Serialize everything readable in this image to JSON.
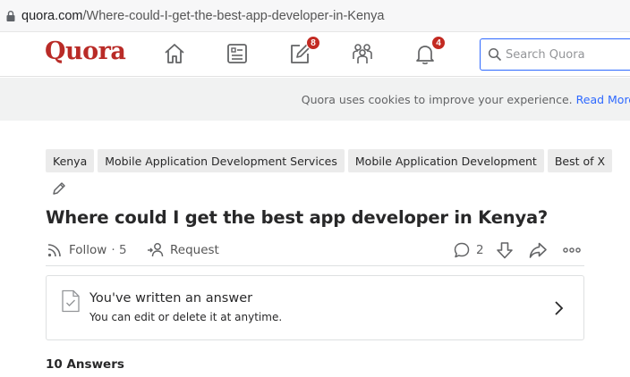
{
  "browser": {
    "url_host": "quora.com",
    "url_path": "/Where-could-I-get-the-best-app-developer-in-Kenya"
  },
  "header": {
    "logo": "Quora",
    "following_badge": "8",
    "notifications_badge": "4",
    "search_placeholder": "Search Quora"
  },
  "cookie_banner": {
    "text": "Quora uses cookies to improve your experience.",
    "link": "Read More"
  },
  "question": {
    "topics": [
      "Kenya",
      "Mobile Application Development Services",
      "Mobile Application Development",
      "Best of X"
    ],
    "title": "Where could I get the best app developer in Kenya?",
    "follow_label": "Follow",
    "follow_count": "· 5",
    "request_label": "Request",
    "comment_count": "2"
  },
  "answer_card": {
    "heading": "You've written an answer",
    "subtext": "You can edit or delete it at anytime."
  },
  "answers_count": "10 Answers",
  "colors": {
    "brand": "#b92b27",
    "accent": "#2e69ff",
    "badge": "#c32a22"
  }
}
